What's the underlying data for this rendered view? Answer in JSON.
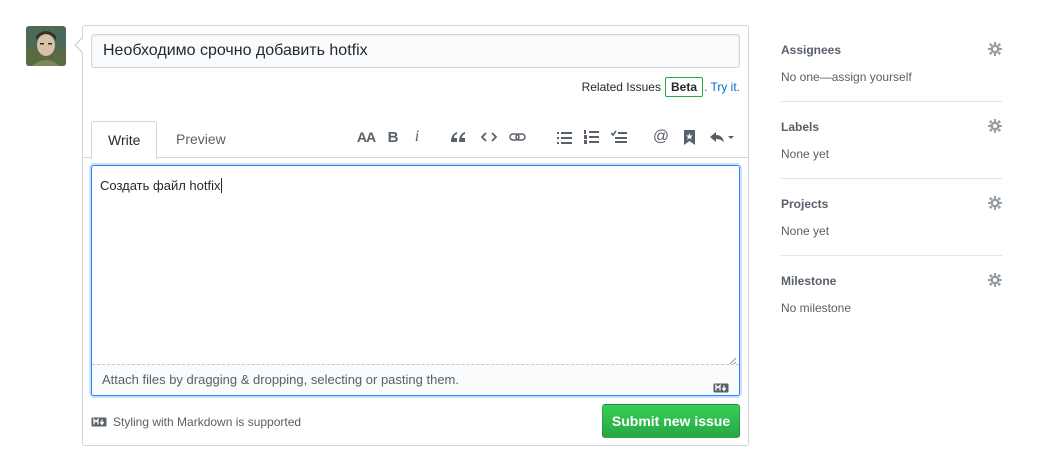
{
  "issue": {
    "title_value": "Необходимо срочно добавить hotfix",
    "related_label": "Related Issues",
    "beta_badge": "Beta",
    "try_it": ". Try it."
  },
  "tabs": {
    "write": "Write",
    "preview": "Preview"
  },
  "toolbar": {
    "icons": [
      "text-size-icon",
      "bold-icon",
      "italic-icon",
      "quote-icon",
      "code-icon",
      "link-icon",
      "unordered-list-icon",
      "ordered-list-icon",
      "task-list-icon",
      "mention-icon",
      "saved-reply-icon",
      "reply-dropdown-icon"
    ],
    "heading_glyph": "AA",
    "bold_glyph": "B",
    "italic_glyph": "i",
    "mention_glyph": "@"
  },
  "editor": {
    "body_value": "Создать файл hotfix",
    "attach_hint": "Attach files by dragging & dropping, selecting or pasting them."
  },
  "footer": {
    "markdown_note": "Styling with Markdown is supported",
    "submit_label": "Submit new issue"
  },
  "sidebar": {
    "sections": [
      {
        "title": "Assignees",
        "value": "No one—assign yourself"
      },
      {
        "title": "Labels",
        "value": "None yet"
      },
      {
        "title": "Projects",
        "value": "None yet"
      },
      {
        "title": "Milestone",
        "value": "No milestone"
      }
    ]
  },
  "colors": {
    "accent": "#0366d6",
    "submit_green": "#28a745",
    "focus_blue": "#2188ff",
    "muted": "#586069"
  }
}
